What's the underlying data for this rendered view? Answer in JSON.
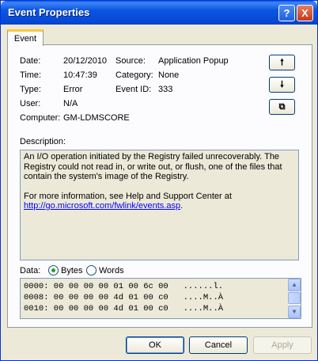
{
  "window": {
    "title": "Event Properties"
  },
  "titlebar_buttons": {
    "help": "?",
    "close": "X"
  },
  "tab": {
    "label": "Event"
  },
  "fields": {
    "date_label": "Date:",
    "date_value": "20/12/2010",
    "source_label": "Source:",
    "source_value": "Application Popup",
    "time_label": "Time:",
    "time_value": "10:47:39",
    "category_label": "Category:",
    "category_value": "None",
    "type_label": "Type:",
    "type_value": "Error",
    "event_id_label": "Event ID:",
    "event_id_value": "333",
    "user_label": "User:",
    "user_value": "N/A",
    "computer_label": "Computer:",
    "computer_value": "GM-LDMSCORE"
  },
  "side_buttons": {
    "up": "🠕",
    "down": "🠗",
    "copy": "⧉"
  },
  "description": {
    "label": "Description:",
    "text1": "An I/O operation initiated by the Registry failed unrecoverably. The Registry could not read in, or write out, or flush, one of the files that contain the system's image of the Registry.",
    "text2": "For more information, see Help and Support Center at",
    "link": "http://go.microsoft.com/fwlink/events.asp",
    "link_suffix": "."
  },
  "data": {
    "label": "Data:",
    "bytes_label": "Bytes",
    "words_label": "Words",
    "selected": "Bytes",
    "lines": [
      "0000: 00 00 00 00 01 00 6c 00   ......l.",
      "0008: 00 00 00 00 4d 01 00 c0   ....M..À",
      "0010: 00 00 00 00 4d 01 00 c0   ....M..À"
    ]
  },
  "scroll_arrows": {
    "up": "▲",
    "down": "▼"
  },
  "buttons": {
    "ok": "OK",
    "cancel": "Cancel",
    "apply": "Apply"
  }
}
